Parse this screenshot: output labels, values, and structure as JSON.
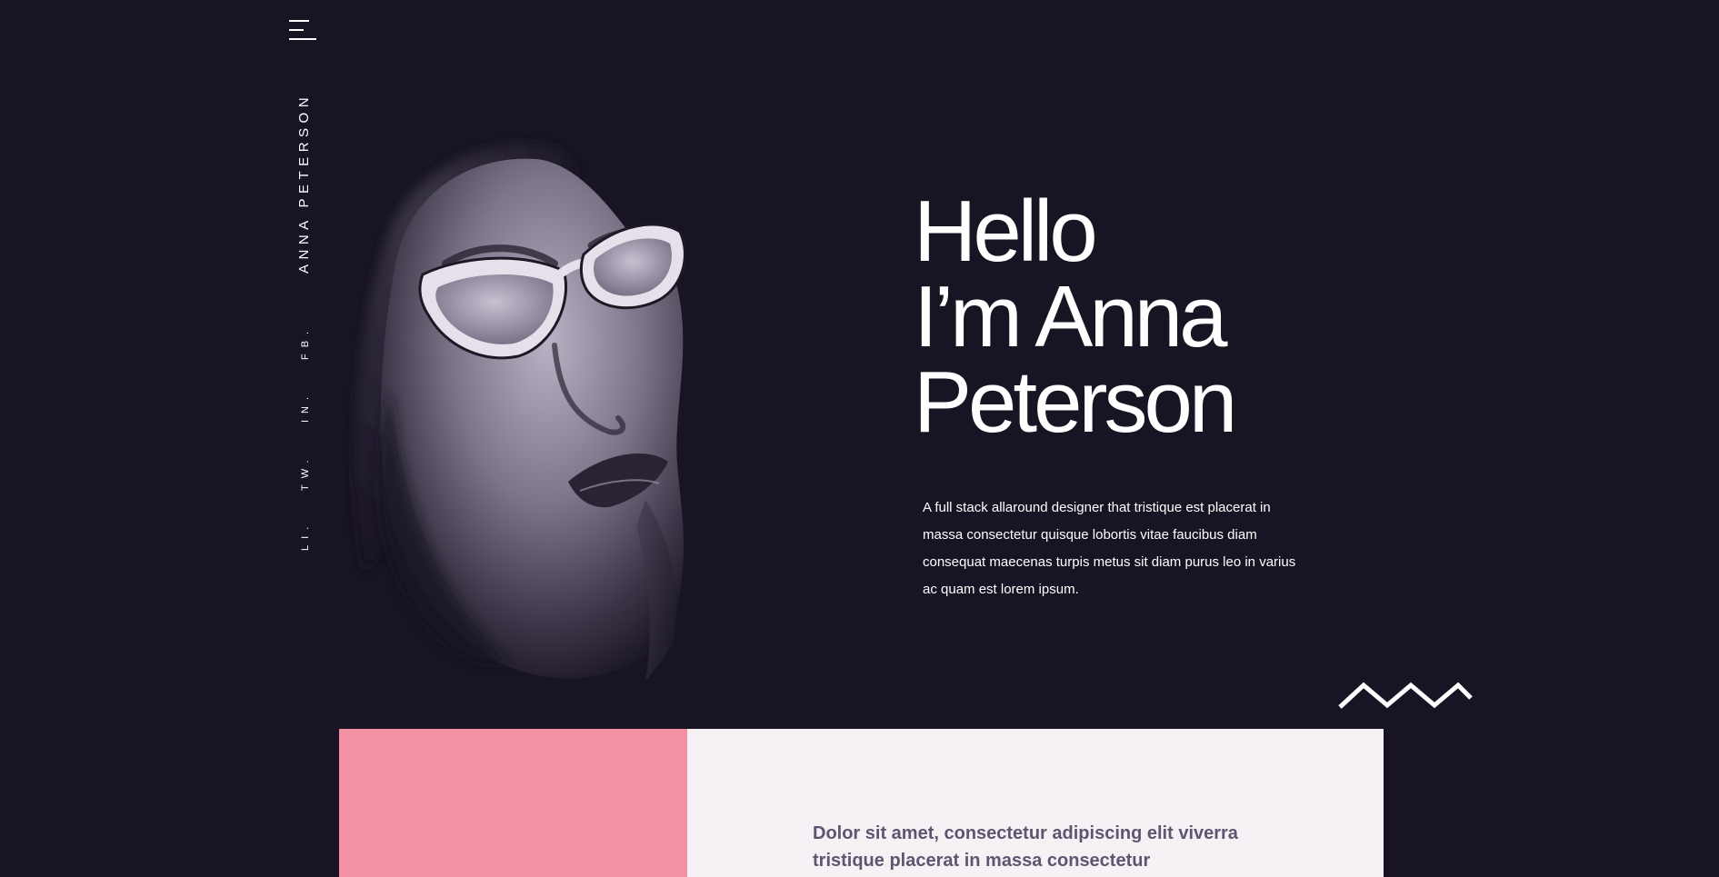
{
  "sidebar": {
    "menu_icon": "hamburger-icon",
    "brand_name": "ANNA PETERSON",
    "social_links": [
      {
        "label": "FB."
      },
      {
        "label": "IN."
      },
      {
        "label": "TW."
      },
      {
        "label": "LI."
      }
    ]
  },
  "hero": {
    "title_lines": [
      "Hello",
      "I’m Anna",
      "Peterson"
    ],
    "description": "A full stack allaround designer that tristique est placerat in massa consectetur quisque lobortis vitae faucibus diam consequat maecenas turpis metus sit diam purus leo in varius ac quam est lorem ipsum.",
    "portrait": "portrait-woman-sunglasses",
    "decoration_icon": "zigzag-icon"
  },
  "about": {
    "lead_text": "Dolor sit amet, consectetur adipiscing elit viverra tristique placerat in massa consectetur"
  },
  "colors": {
    "background": "#181423",
    "accent_pink": "#f391a4",
    "panel_light": "#f6f1f5",
    "text_muted": "#5d5670"
  }
}
